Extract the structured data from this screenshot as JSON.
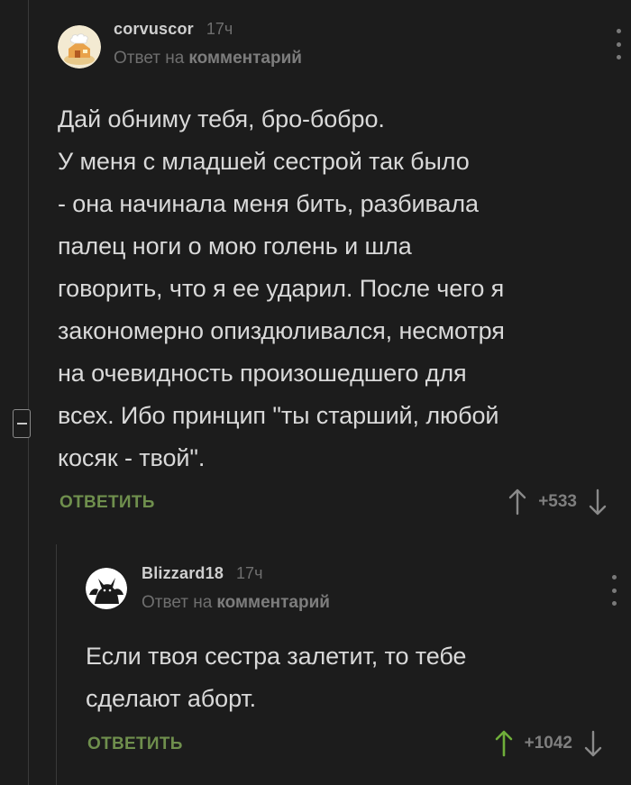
{
  "comments": [
    {
      "author": "corvuscor",
      "time": "17ч",
      "reply_prefix": "Ответ на",
      "reply_link": "комментарий",
      "text": "Дай обниму тебя, бро-бобро.\nУ меня с младшей сестрой так было\n- она начинала меня бить, разбивала\nпалец ноги о мою голень и шла\nговорить, что я ее ударил. После чего я\nзакономерно опиздюливался, несмотря\nна очевидность произошедшего для\nвсех. Ибо принцип \"ты старший, любой\nкосяк - твой\".",
      "reply_label": "ОТВЕТИТЬ",
      "rating": "+533",
      "upvoted": false,
      "avatar_icon": "chef-house-avatar"
    },
    {
      "author": "Blizzard18",
      "time": "17ч",
      "reply_prefix": "Ответ на",
      "reply_link": "комментарий",
      "text": "Если твоя сестра залетит, то тебе\nсделают аборт.",
      "reply_label": "ОТВЕТИТЬ",
      "rating": "+1042",
      "upvoted": true,
      "avatar_icon": "demon-silhouette-avatar"
    }
  ],
  "colors": {
    "background": "#1c1c1c",
    "text": "#d9d9d9",
    "muted": "#6f6f6f",
    "reply_green": "#6f8f4d",
    "upvote_green": "#6fae3a"
  }
}
